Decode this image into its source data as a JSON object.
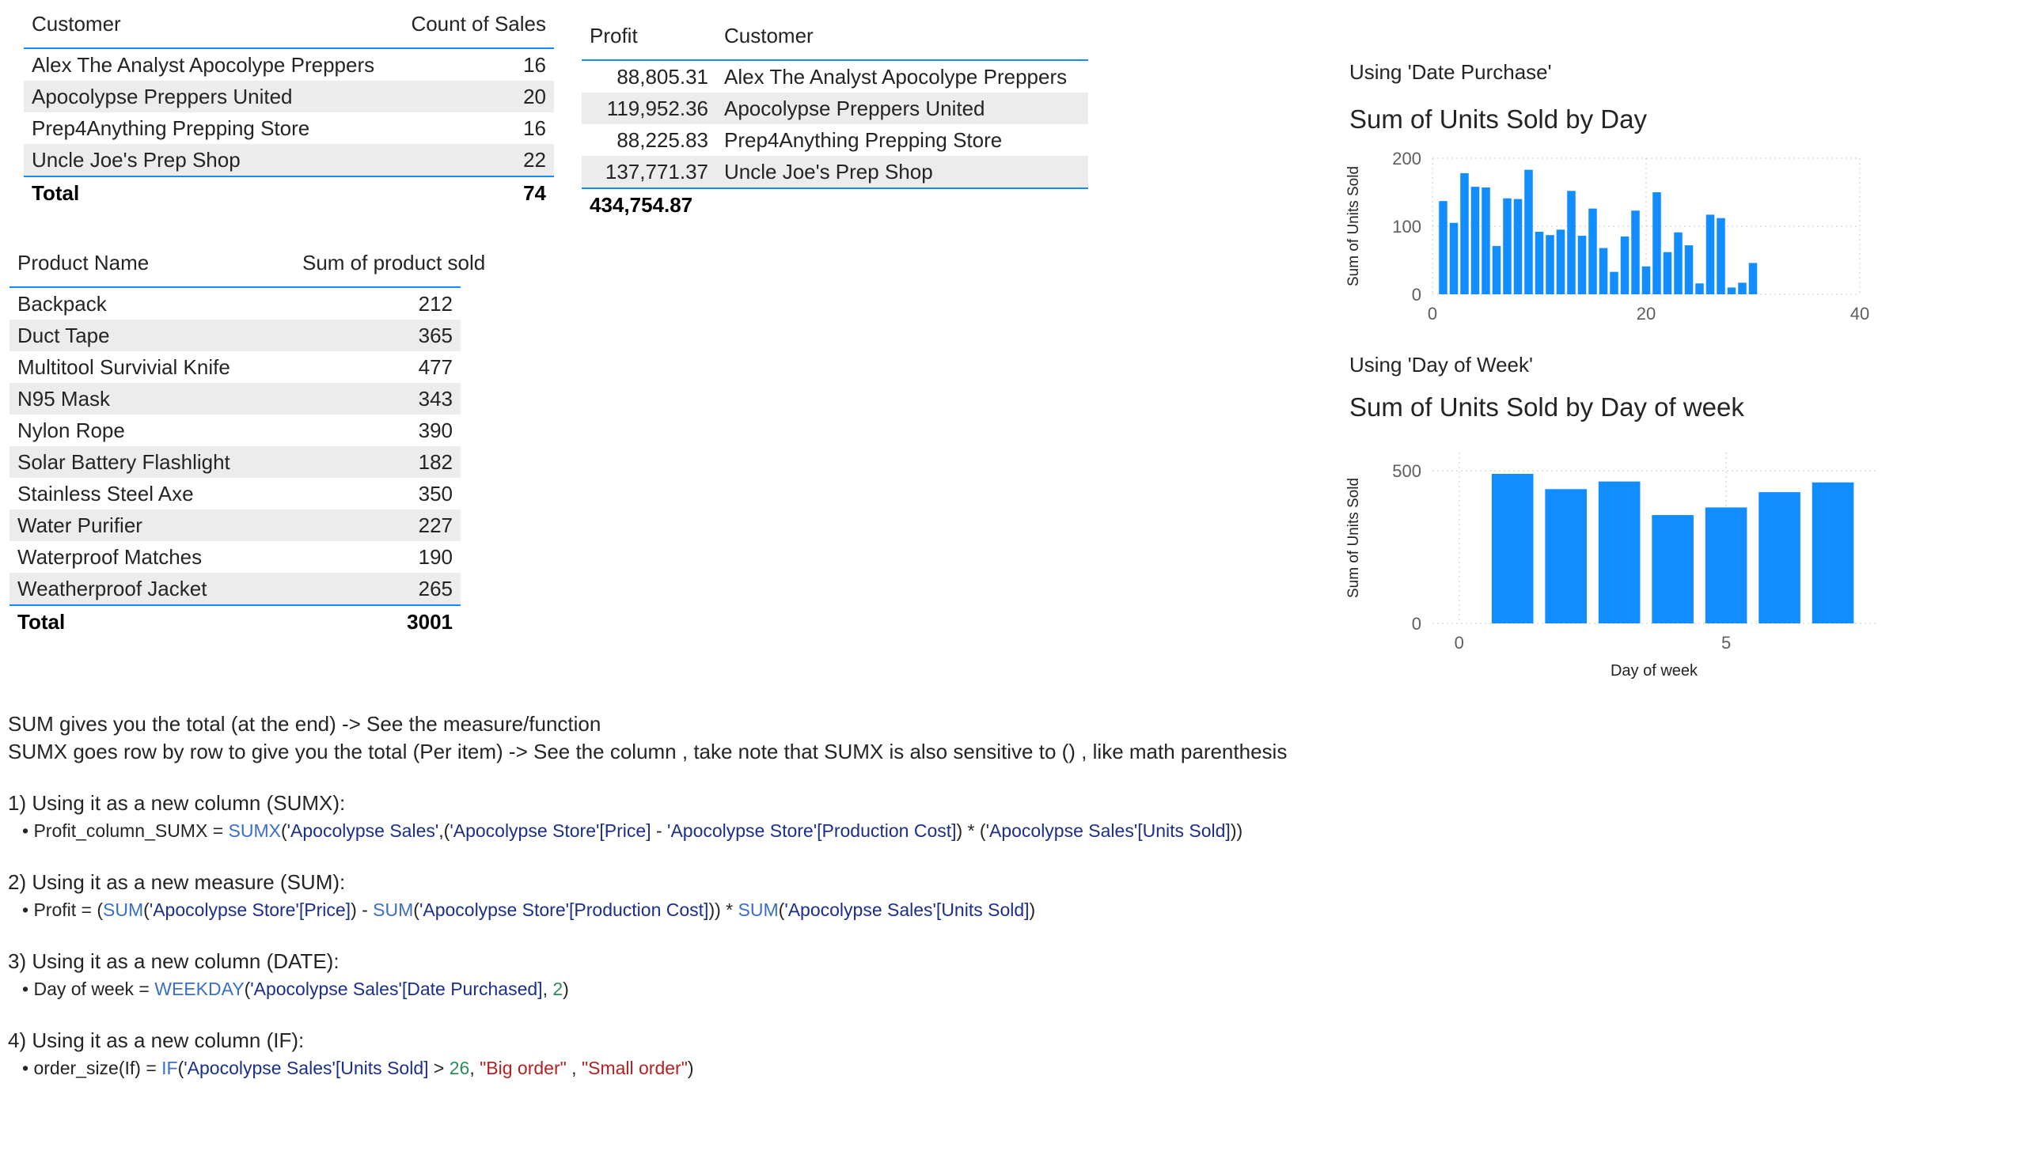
{
  "table_customers": {
    "headers": [
      "Customer",
      "Count of Sales"
    ],
    "rows": [
      {
        "name": "Alex The Analyst Apocolype Preppers",
        "value": "16"
      },
      {
        "name": "Apocolypse Preppers United",
        "value": "20"
      },
      {
        "name": "Prep4Anything Prepping Store",
        "value": "16"
      },
      {
        "name": "Uncle Joe's Prep Shop",
        "value": "22"
      }
    ],
    "total_label": "Total",
    "total_value": "74"
  },
  "table_profit": {
    "headers": [
      "Profit",
      "Customer"
    ],
    "rows": [
      {
        "profit": "88,805.31",
        "name": "Alex The Analyst Apocolype Preppers"
      },
      {
        "profit": "119,952.36",
        "name": "Apocolypse Preppers United"
      },
      {
        "profit": "88,225.83",
        "name": "Prep4Anything Prepping Store"
      },
      {
        "profit": "137,771.37",
        "name": "Uncle Joe's Prep Shop"
      }
    ],
    "total_value": "434,754.87"
  },
  "table_products": {
    "headers": [
      "Product Name",
      "Sum of product sold"
    ],
    "rows": [
      {
        "name": "Backpack",
        "value": "212"
      },
      {
        "name": "Duct Tape",
        "value": "365"
      },
      {
        "name": "Multitool Survivial Knife",
        "value": "477"
      },
      {
        "name": "N95 Mask",
        "value": "343"
      },
      {
        "name": "Nylon Rope",
        "value": "390"
      },
      {
        "name": "Solar Battery Flashlight",
        "value": "182"
      },
      {
        "name": "Stainless Steel Axe",
        "value": "350"
      },
      {
        "name": "Water Purifier",
        "value": "227"
      },
      {
        "name": "Waterproof Matches",
        "value": "190"
      },
      {
        "name": "Weatherproof Jacket",
        "value": "265"
      }
    ],
    "total_label": "Total",
    "total_value": "3001"
  },
  "chart_captions": {
    "day_caption": "Using 'Date Purchase'",
    "week_caption": "Using 'Day of Week'"
  },
  "chart_data": [
    {
      "type": "bar",
      "title": "Sum of Units Sold by Day",
      "xlabel": "",
      "ylabel": "Sum of Units Sold",
      "xlim": [
        0,
        40
      ],
      "ylim": [
        0,
        200
      ],
      "xticks": [
        0,
        20,
        40
      ],
      "yticks": [
        0,
        100,
        200
      ],
      "grid": true,
      "color": "#118DFF",
      "x": [
        1,
        2,
        3,
        4,
        5,
        6,
        7,
        8,
        9,
        10,
        11,
        12,
        13,
        14,
        15,
        16,
        17,
        18,
        19,
        20,
        21,
        22,
        23,
        24,
        25,
        26,
        27,
        28,
        29,
        30,
        31
      ],
      "values": [
        137,
        105,
        178,
        158,
        157,
        71,
        141,
        140,
        183,
        92,
        87,
        95,
        152,
        86,
        126,
        68,
        33,
        85,
        123,
        41,
        150,
        62,
        91,
        72,
        16,
        117,
        112,
        10,
        17,
        46,
        0
      ]
    },
    {
      "type": "bar",
      "title": "Sum of Units Sold by Day of week",
      "xlabel": "Day of week",
      "ylabel": "Sum of Units Sold",
      "xlim": [
        -0.5,
        7.8
      ],
      "ylim": [
        0,
        560
      ],
      "xticks": [
        0,
        5
      ],
      "yticks": [
        0,
        500
      ],
      "grid": true,
      "color": "#118DFF",
      "x": [
        1,
        2,
        3,
        4,
        5,
        6,
        7
      ],
      "values": [
        490,
        440,
        465,
        355,
        380,
        430,
        462
      ]
    }
  ],
  "notes": {
    "line1": "SUM gives you the total (at the end) -> See the measure/function",
    "line2": "SUMX goes row by row to give you the total (Per item) -> See the column , take note that SUMX is also sensitive to () , like math parenthesis",
    "h1": "1) Using it as a new column (SUMX):",
    "f1": {
      "bullet": "• ",
      "lhs": "Profit_column_SUMX = ",
      "fn": "SUMX",
      "p1": "(",
      "r1": "'Apocolypse Sales'",
      "p2": ",(",
      "r2": "'Apocolypse Store'[Price]",
      "p3": " - ",
      "r3": "'Apocolypse Store'[Production Cost]",
      "p4": ") * (",
      "r4": "'Apocolypse Sales'[Units Sold]",
      "p5": "))"
    },
    "h2": "2) Using it as a new measure (SUM):",
    "f2": {
      "bullet": "• ",
      "lhs": "Profit = (",
      "fn1": "SUM",
      "p1": "(",
      "r1": "'Apocolypse Store'[Price]",
      "p2": ") - ",
      "fn2": "SUM",
      "p3": "(",
      "r2": "'Apocolypse Store'[Production Cost]",
      "p4": ")) * ",
      "fn3": "SUM",
      "p5": "(",
      "r3": "'Apocolypse Sales'[Units Sold]",
      "p6": ")"
    },
    "h3": "3) Using it as a new column (DATE):",
    "f3": {
      "bullet": "• ",
      "lhs": "Day of week = ",
      "fn": "WEEKDAY",
      "p1": "(",
      "r1": "'Apocolypse Sales'[Date Purchased]",
      "p2": ", ",
      "n1": "2",
      "p3": ")"
    },
    "h4": "4) Using it as a new column (IF):",
    "f4": {
      "bullet": "• ",
      "lhs": "order_size(If) = ",
      "fn": "IF",
      "p1": "(",
      "r1": "'Apocolypse Sales'[Units Sold]",
      "p2": " > ",
      "n1": "26",
      "p3": ", ",
      "s1": "\"Big order\"",
      "p4": " , ",
      "s2": "\"Small order\"",
      "p5": ")"
    }
  }
}
